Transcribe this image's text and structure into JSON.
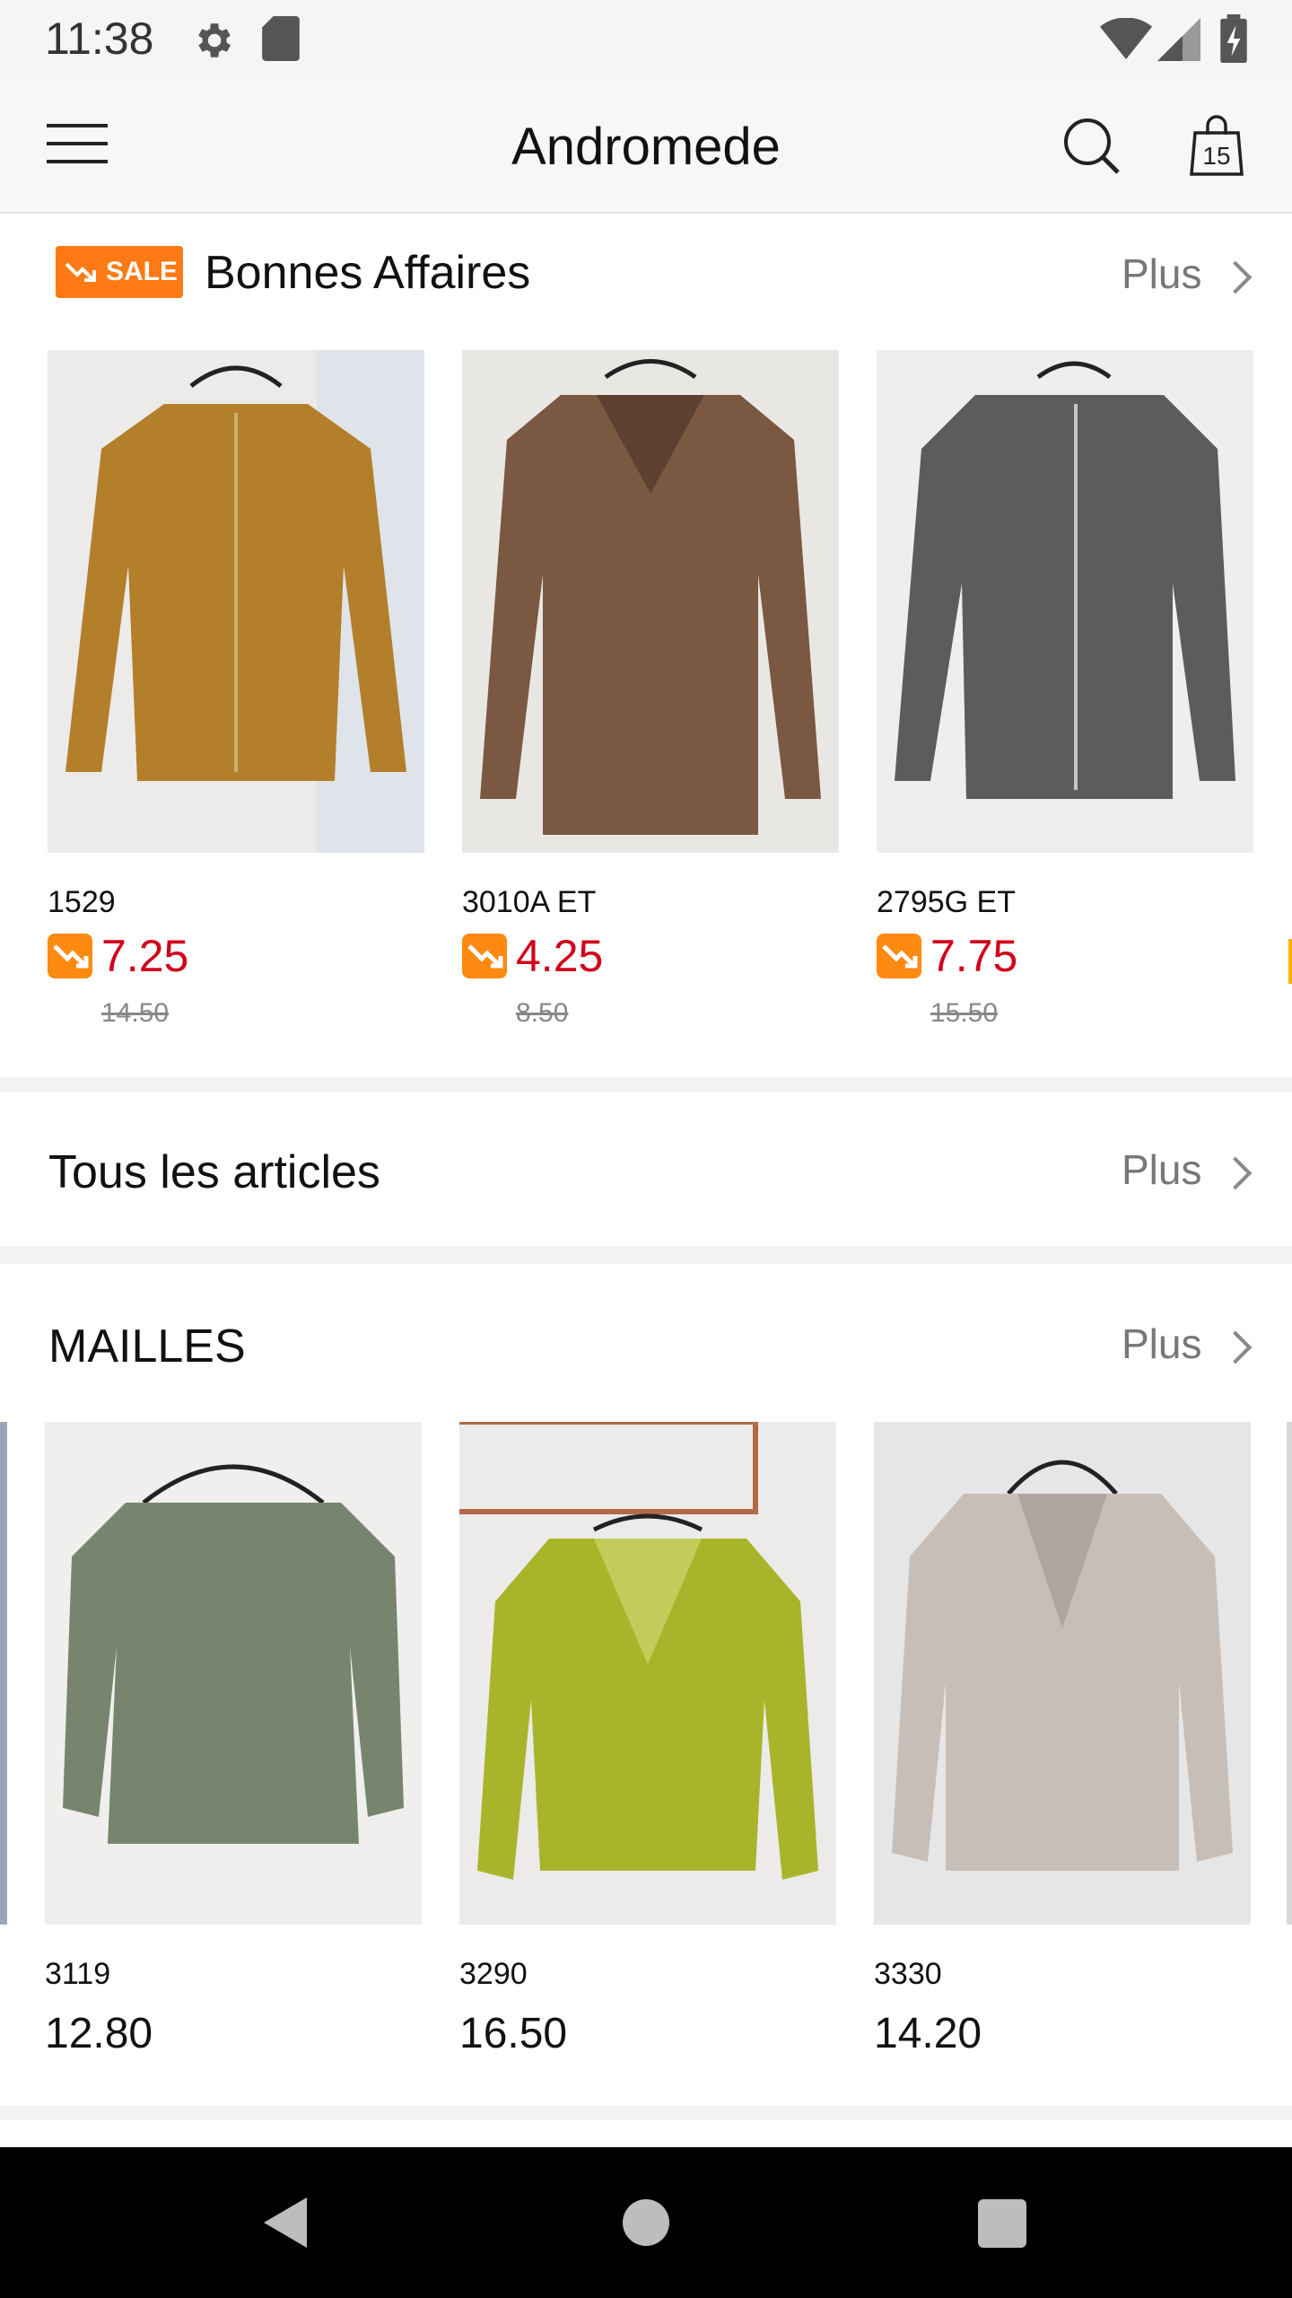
{
  "status_bar": {
    "time": "11:38"
  },
  "app_bar": {
    "title": "Andromede",
    "cart_count": "15"
  },
  "sale_section": {
    "badge": "SALE",
    "title": "Bonnes Affaires",
    "more": "Plus",
    "items": [
      {
        "code": "1529",
        "price": "7.25",
        "old_price": "14.50"
      },
      {
        "code": "3010A ET",
        "price": "4.25",
        "old_price": "8.50"
      },
      {
        "code": "2795G ET",
        "price": "7.75",
        "old_price": "15.50"
      }
    ]
  },
  "all_section": {
    "title": "Tous les articles",
    "more": "Plus"
  },
  "mailles_section": {
    "title": "MAILLES",
    "more": "Plus",
    "items": [
      {
        "code": "3119",
        "price": "12.80"
      },
      {
        "code": "3290",
        "price": "16.50"
      },
      {
        "code": "3330",
        "price": "14.20"
      }
    ]
  },
  "colors": {
    "accent": "#ff7a14",
    "sale_price": "#d0021b"
  }
}
